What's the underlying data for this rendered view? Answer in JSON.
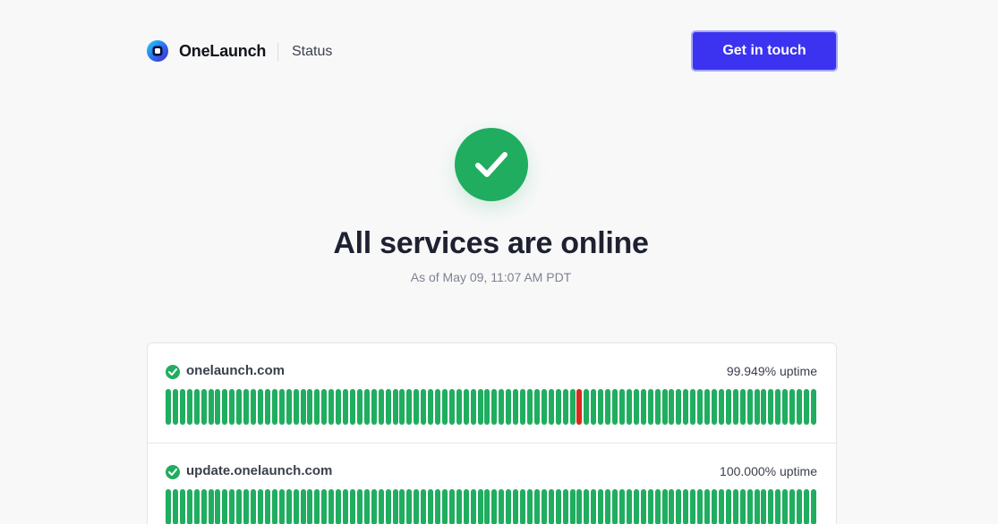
{
  "header": {
    "brand_name": "OneLaunch",
    "section_label": "Status",
    "cta_label": "Get in touch"
  },
  "hero": {
    "icon": "check-icon",
    "title": "All services are online",
    "subtitle": "As of May 09, 11:07 AM PDT"
  },
  "colors": {
    "accent": "#3b33f0",
    "operational": "#20ad5f",
    "outage": "#d62b1f"
  },
  "services": [
    {
      "name": "onelaunch.com",
      "uptime": "99.949% uptime",
      "status_icon": "check-circle-icon",
      "days": [
        "up",
        "up",
        "up",
        "up",
        "up",
        "up",
        "up",
        "up",
        "up",
        "up",
        "up",
        "up",
        "up",
        "up",
        "up",
        "up",
        "up",
        "up",
        "up",
        "up",
        "up",
        "up",
        "up",
        "up",
        "up",
        "up",
        "up",
        "up",
        "up",
        "up",
        "up",
        "up",
        "up",
        "up",
        "up",
        "up",
        "up",
        "up",
        "up",
        "up",
        "up",
        "up",
        "up",
        "up",
        "up",
        "up",
        "up",
        "up",
        "up",
        "up",
        "up",
        "up",
        "up",
        "up",
        "up",
        "up",
        "up",
        "up",
        "down",
        "up",
        "up",
        "up",
        "up",
        "up",
        "up",
        "up",
        "up",
        "up",
        "up",
        "up",
        "up",
        "up",
        "up",
        "up",
        "up",
        "up",
        "up",
        "up",
        "up",
        "up",
        "up",
        "up",
        "up",
        "up",
        "up",
        "up",
        "up",
        "up",
        "up",
        "up",
        "up",
        "up"
      ]
    },
    {
      "name": "update.onelaunch.com",
      "uptime": "100.000% uptime",
      "status_icon": "check-circle-icon",
      "days": [
        "up",
        "up",
        "up",
        "up",
        "up",
        "up",
        "up",
        "up",
        "up",
        "up",
        "up",
        "up",
        "up",
        "up",
        "up",
        "up",
        "up",
        "up",
        "up",
        "up",
        "up",
        "up",
        "up",
        "up",
        "up",
        "up",
        "up",
        "up",
        "up",
        "up",
        "up",
        "up",
        "up",
        "up",
        "up",
        "up",
        "up",
        "up",
        "up",
        "up",
        "up",
        "up",
        "up",
        "up",
        "up",
        "up",
        "up",
        "up",
        "up",
        "up",
        "up",
        "up",
        "up",
        "up",
        "up",
        "up",
        "up",
        "up",
        "up",
        "up",
        "up",
        "up",
        "up",
        "up",
        "up",
        "up",
        "up",
        "up",
        "up",
        "up",
        "up",
        "up",
        "up",
        "up",
        "up",
        "up",
        "up",
        "up",
        "up",
        "up",
        "up",
        "up",
        "up",
        "up",
        "up",
        "up",
        "up",
        "up",
        "up",
        "up",
        "up",
        "up"
      ]
    }
  ]
}
